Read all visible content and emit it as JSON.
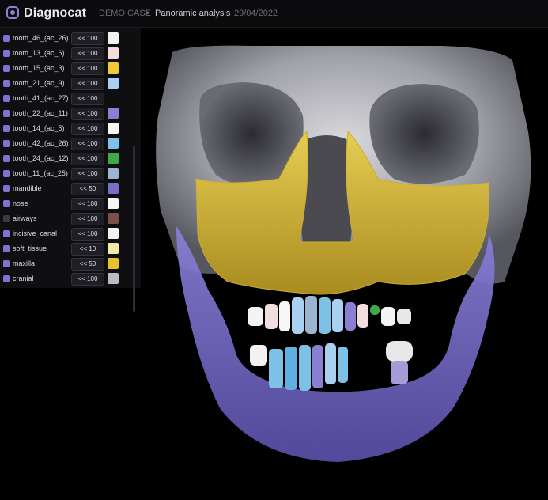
{
  "header": {
    "app_name": "Diagnocat",
    "case_label": "DEMO CASE",
    "separator": ">",
    "page_title": "Panoramic analysis",
    "date": "29/04/2022"
  },
  "layers": [
    {
      "label": "tooth_46_(ac_26)",
      "opacity": "<< 100",
      "color": "#f2f2f2",
      "visible": true
    },
    {
      "label": "tooth_13_(ac_6)",
      "opacity": "<< 100",
      "color": "#f3dede",
      "visible": true
    },
    {
      "label": "tooth_15_(ac_3)",
      "opacity": "<< 100",
      "color": "#f0c838",
      "visible": true
    },
    {
      "label": "tooth_21_(ac_9)",
      "opacity": "<< 100",
      "color": "#a9d0f0",
      "visible": true
    },
    {
      "label": "tooth_41_(ac_27)",
      "opacity": "<< 100",
      "color": "",
      "visible": true
    },
    {
      "label": "tooth_22_(ac_11)",
      "opacity": "<< 100",
      "color": "#8a7fd2",
      "visible": true
    },
    {
      "label": "tooth_14_(ac_5)",
      "opacity": "<< 100",
      "color": "#f6f6f6",
      "visible": true
    },
    {
      "label": "tooth_42_(ac_26)",
      "opacity": "<< 100",
      "color": "#7dc2e6",
      "visible": true
    },
    {
      "label": "tooth_24_(ac_12)",
      "opacity": "<< 100",
      "color": "#3fa84a",
      "visible": true
    },
    {
      "label": "tooth_11_(ac_25)",
      "opacity": "<< 100",
      "color": "#9bb4d0",
      "visible": true
    },
    {
      "label": "mandible",
      "opacity": "<< 50",
      "color": "#7a6fc8",
      "visible": true
    },
    {
      "label": "nose",
      "opacity": "<< 100",
      "color": "#f6f6f6",
      "visible": true
    },
    {
      "label": "airways",
      "opacity": "<< 100",
      "color": "#7a5048",
      "visible": false
    },
    {
      "label": "incisive_canal",
      "opacity": "<< 100",
      "color": "#f2f2f2",
      "visible": true
    },
    {
      "label": "soft_tissue",
      "opacity": "<< 10",
      "color": "#f2eaa8",
      "visible": true
    },
    {
      "label": "maxilla",
      "opacity": "<< 50",
      "color": "#e8c030",
      "visible": true
    },
    {
      "label": "cranial",
      "opacity": "<< 100",
      "color": "#b8bcc4",
      "visible": true
    }
  ]
}
